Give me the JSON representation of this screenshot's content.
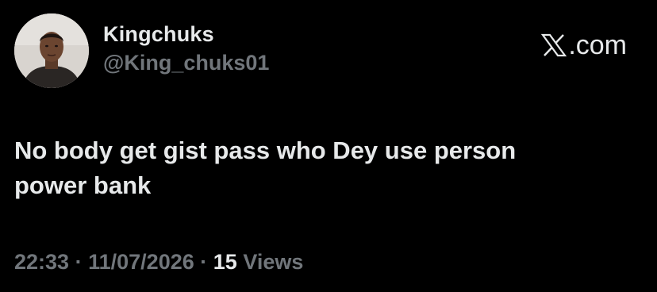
{
  "author": {
    "display_name": "Kingchuks",
    "handle": "@King_chuks01",
    "avatar_icon": "profile-photo"
  },
  "brand": {
    "logo_icon": "x-logo-icon",
    "suffix": ".com"
  },
  "tweet": {
    "text_line1": "No body get gist pass who Dey use person",
    "text_line2": "power bank"
  },
  "meta": {
    "time": "22:33",
    "separator": "·",
    "date": "11/07/2026",
    "views_count": "15",
    "views_label": "Views"
  },
  "colors": {
    "background": "#000000",
    "primary_text": "#e7e9ea",
    "secondary_text": "#71767b"
  }
}
